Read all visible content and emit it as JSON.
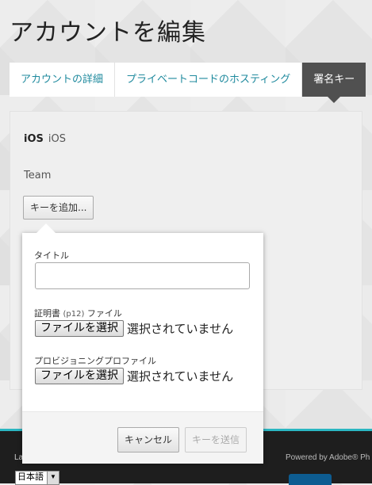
{
  "page": {
    "title": "アカウントを編集"
  },
  "tabs": [
    {
      "label": "アカウントの詳細"
    },
    {
      "label": "プライベートコードのホスティング"
    },
    {
      "label": "署名キー"
    }
  ],
  "panel": {
    "platform_bold": "iOS",
    "platform_sub": "iOS",
    "team_label": "Team",
    "add_key_label": "キーを追加..."
  },
  "popover": {
    "title_label": "タイトル",
    "title_value": "",
    "cert_label": "証明書",
    "cert_hint": "(p12)",
    "cert_suffix": "ファイル",
    "cert_button": "ファイルを選択",
    "cert_status": "選択されていません",
    "profile_label": "プロビジョニングプロファイル",
    "profile_button": "ファイルを選択",
    "profile_status": "選択されていません",
    "cancel_label": "キャンセル",
    "submit_label": "キーを送信"
  },
  "footer": {
    "language_label": "La",
    "language_value": "日本語",
    "powered_by": "Powered by Adobe® Ph"
  },
  "colors": {
    "accent": "#2bb7c2",
    "tab_active": "#505050",
    "tab_text": "#1f8a9e"
  }
}
